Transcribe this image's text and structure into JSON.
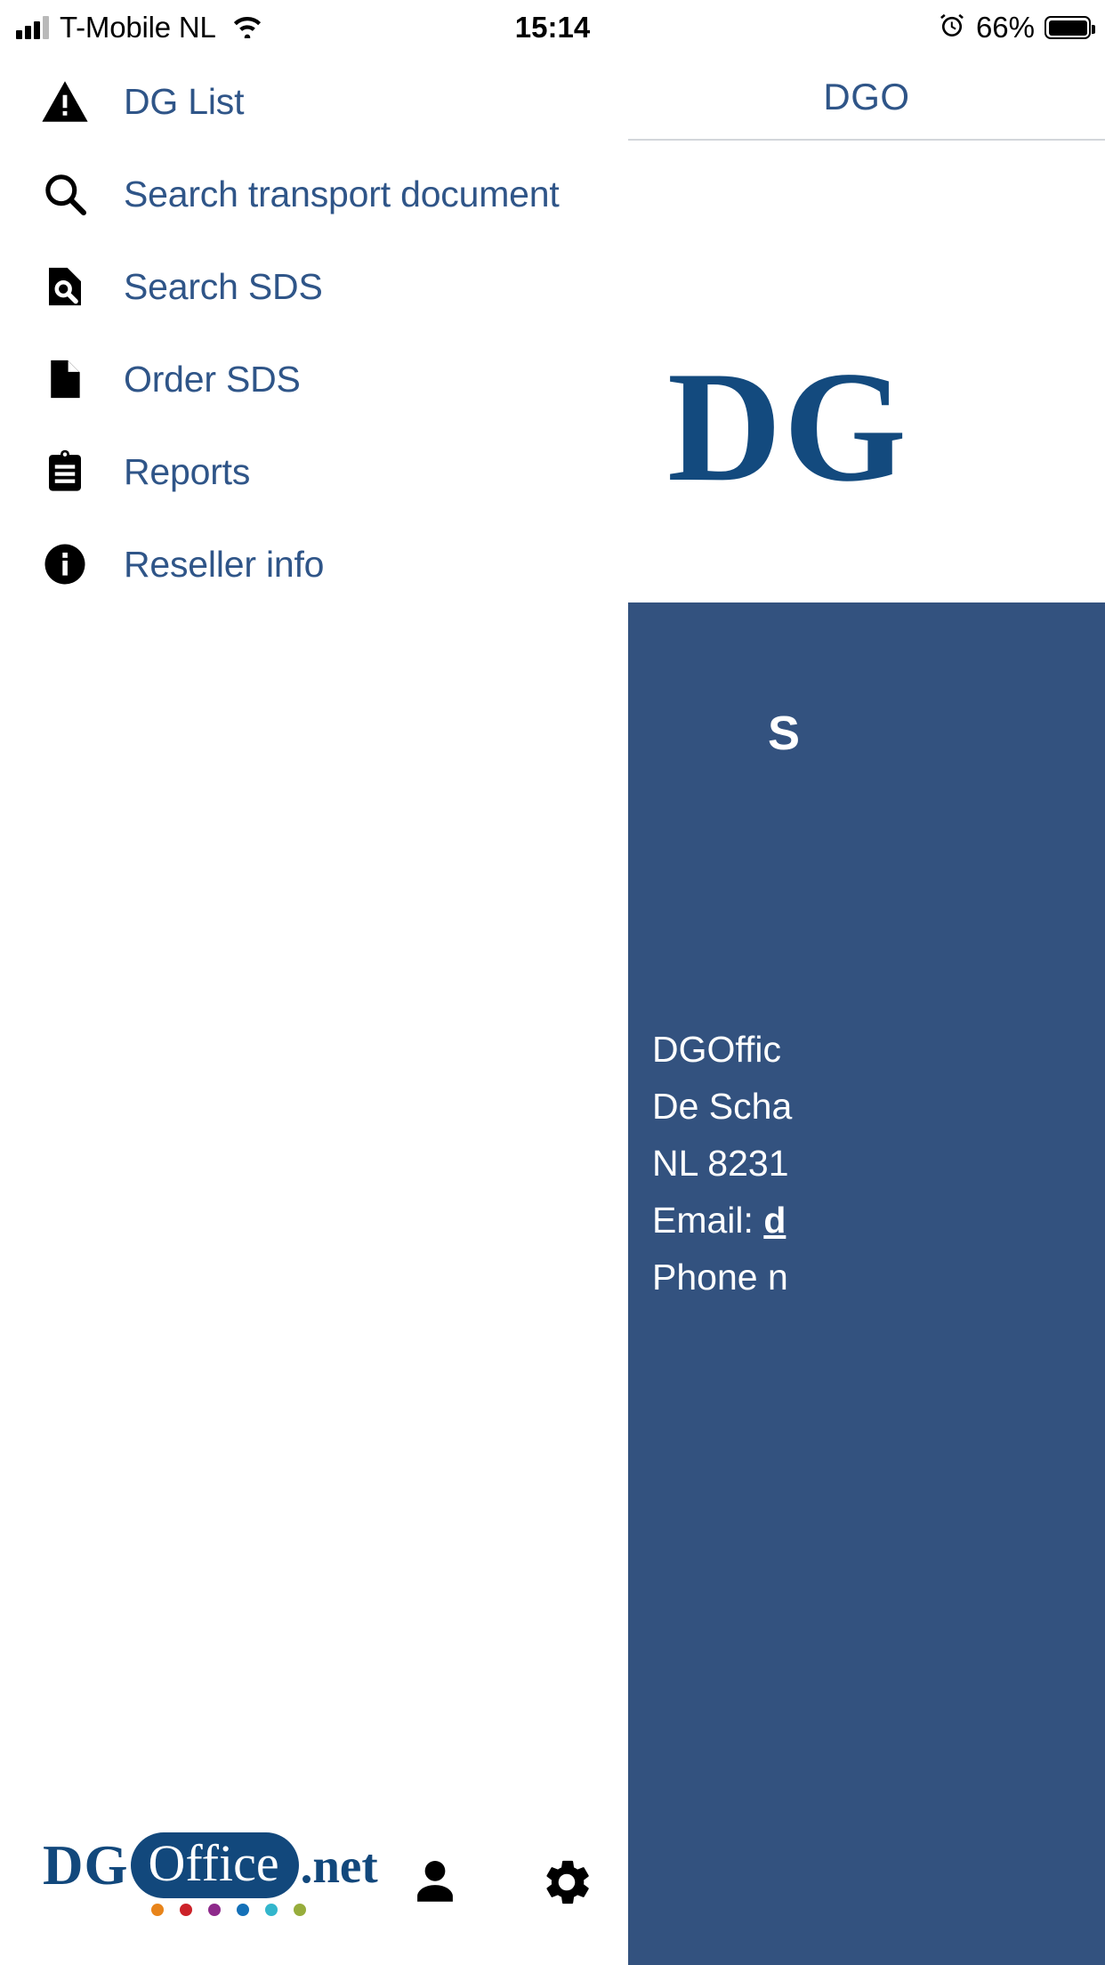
{
  "status_bar": {
    "carrier": "T-Mobile NL",
    "wifi_icon": "wifi-icon",
    "signal_icon": "cellular-signal-icon",
    "time": "15:14",
    "alarm_icon": "alarm-clock-icon",
    "battery_percent": "66%",
    "battery_icon": "battery-icon"
  },
  "nav": {
    "items": [
      {
        "label": "DG List",
        "icon": "warning-triangle-icon"
      },
      {
        "label": "Search transport document",
        "icon": "magnifier-icon"
      },
      {
        "label": "Search SDS",
        "icon": "document-search-icon"
      },
      {
        "label": "Order SDS",
        "icon": "document-icon"
      },
      {
        "label": "Reports",
        "icon": "clipboard-icon"
      },
      {
        "label": "Reseller info",
        "icon": "info-circle-icon"
      }
    ]
  },
  "pane": {
    "tab_label": "DGO",
    "logo_text": "DG",
    "card": {
      "title": "S",
      "lines": [
        "DGOffic",
        "De Scha",
        "NL 8231",
        "Phone n"
      ],
      "email_prefix": "Email: ",
      "email_link": "d"
    }
  },
  "footer": {
    "logo": {
      "dg": "DG",
      "office": "Office",
      "net": ".net"
    },
    "logo_dot_colors": [
      "#e8841a",
      "#cc2229",
      "#8e2a8b",
      "#1470b8",
      "#33b6cc",
      "#97ad3c"
    ],
    "user_icon": "person-icon",
    "settings_icon": "gear-icon"
  },
  "colors": {
    "link_blue": "#2f5588",
    "brand_navy": "#12487c",
    "card_blue": "#33527f"
  }
}
